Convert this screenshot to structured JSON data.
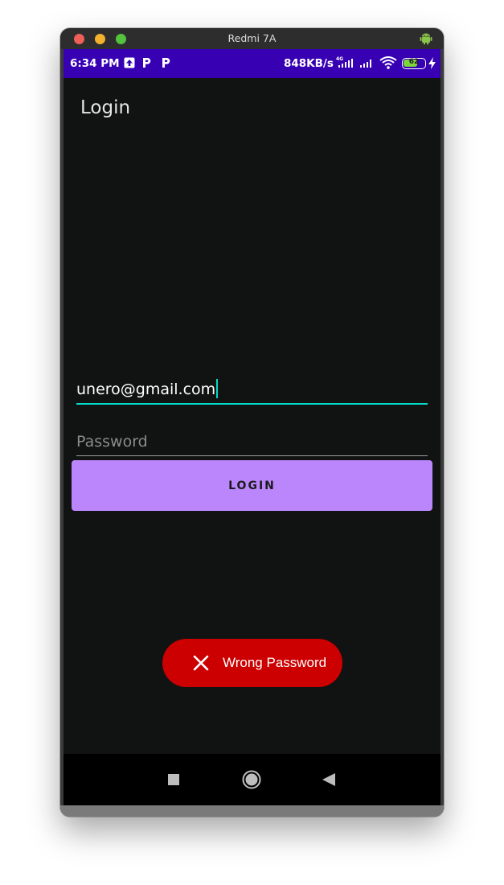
{
  "window": {
    "title": "Redmi 7A",
    "android_icon": "android-icon"
  },
  "status_bar": {
    "time": "6:34 PM",
    "speed": "848KB/s",
    "battery": "62",
    "network": "4G",
    "icons": [
      "upload-icon",
      "p-app-icon",
      "p-app-icon",
      "signal-icon",
      "signal-icon",
      "wifi-icon",
      "battery-icon",
      "charging-icon"
    ],
    "background": "#3700b3"
  },
  "app": {
    "title": "Login",
    "email_value": "unero@gmail.com",
    "password_placeholder": "Password",
    "login_label": "LOGIN",
    "accent": "#03dac5",
    "button_color": "#bb86fc"
  },
  "toast": {
    "icon": "close-icon",
    "message": "Wrong Password",
    "color": "#cc0000"
  },
  "nav": {
    "buttons": [
      "recents-icon",
      "home-icon",
      "back-icon"
    ]
  }
}
